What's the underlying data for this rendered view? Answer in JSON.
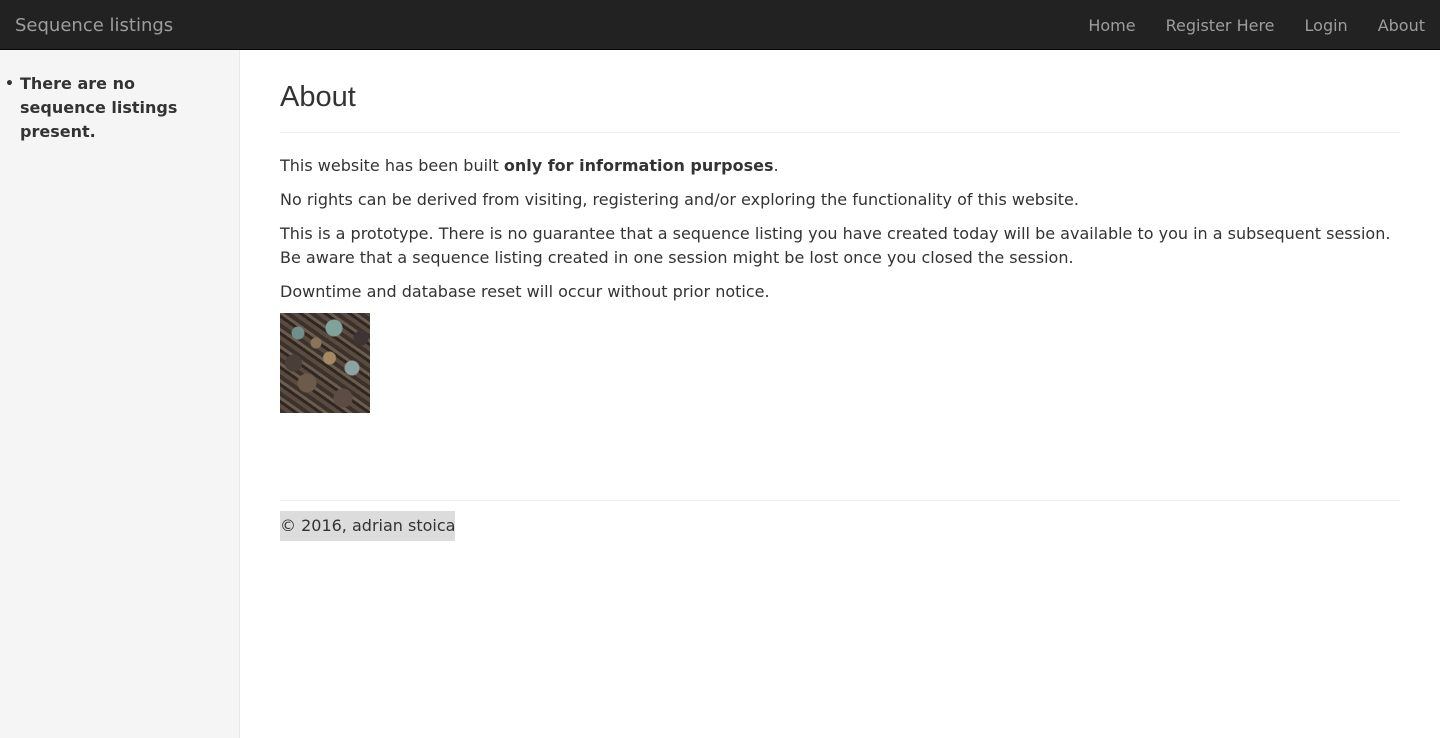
{
  "navbar": {
    "brand": "Sequence listings",
    "links": [
      {
        "label": "Home"
      },
      {
        "label": "Register Here"
      },
      {
        "label": "Login"
      },
      {
        "label": "About"
      }
    ]
  },
  "sidebar": {
    "items": [
      {
        "label": "There are no sequence listings present."
      }
    ]
  },
  "main": {
    "title": "About",
    "p1_before": "This website has been built ",
    "p1_bold": "only for information purposes",
    "p1_after": ".",
    "p2": "No rights can be derived from visiting, registering and/or exploring the functionality of this website.",
    "p3": "This is a prototype. There is no guarantee that a sequence listing you have created today will be available to you in a subsequent session. Be aware that a sequence listing created in one session might be lost once you closed the session.",
    "p4": "Downtime and database reset will occur without prior notice."
  },
  "footer": {
    "text": "© 2016, adrian stoica"
  }
}
